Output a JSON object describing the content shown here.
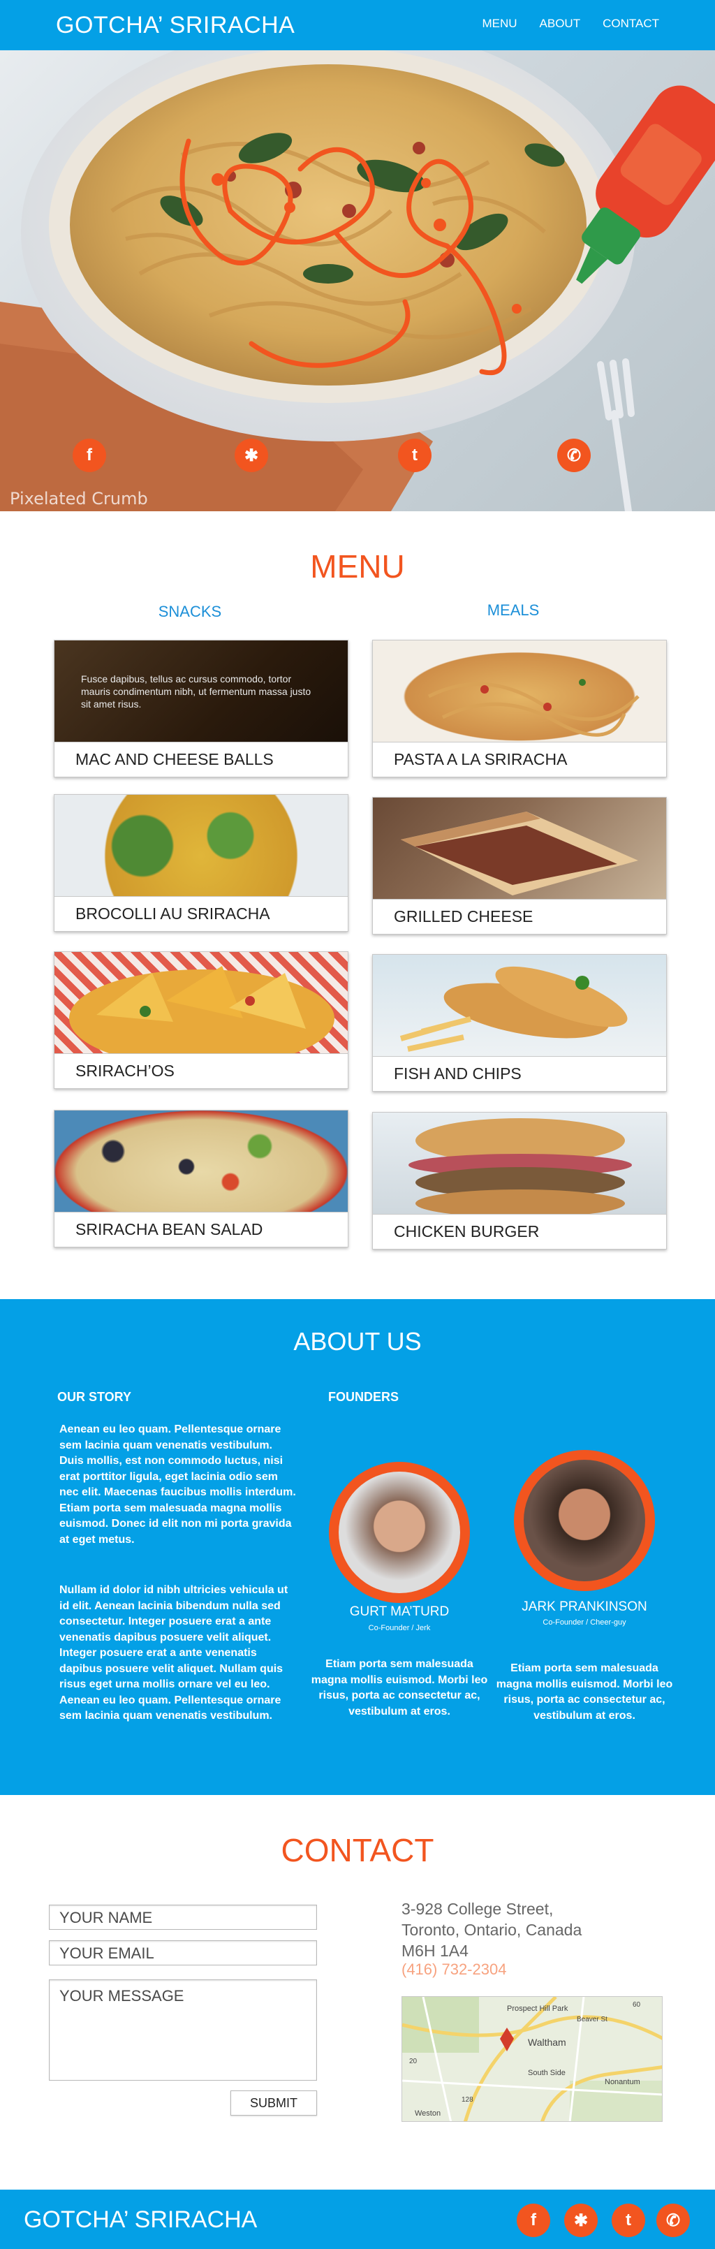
{
  "header": {
    "logo": "GOTCHA’ SRIRACHA",
    "nav": [
      "MENU",
      "ABOUT",
      "CONTACT"
    ]
  },
  "hero": {
    "watermark": "Pixelated Crumb",
    "social_icons": [
      "facebook-icon",
      "yelp-icon",
      "twitter-icon",
      "phone-icon"
    ]
  },
  "menu": {
    "title": "MENU",
    "snacks_heading": "SNACKS",
    "meals_heading": "MEALS",
    "snacks": [
      {
        "name": "MAC AND CHEESE BALLS",
        "overlay": "Fusce dapibus, tellus ac cursus commodo, tortor mauris condimentum nibh, ut fermentum massa justo sit amet risus."
      },
      {
        "name": "BROCOLLI AU SRIRACHA"
      },
      {
        "name": "SRIRACH’OS"
      },
      {
        "name": "SRIRACHA BEAN SALAD"
      }
    ],
    "meals": [
      {
        "name": "PASTA A LA SRIRACHA"
      },
      {
        "name": "GRILLED CHEESE"
      },
      {
        "name": "FISH AND CHIPS"
      },
      {
        "name": "CHICKEN BURGER"
      }
    ]
  },
  "about": {
    "title": "ABOUT US",
    "story_heading": "OUR STORY",
    "founders_heading": "FOUNDERS",
    "story_paragraphs": [
      "Aenean eu leo quam. Pellentesque ornare sem lacinia quam venenatis vestibulum. Duis mollis, est non commodo luctus, nisi erat porttitor ligula, eget lacinia odio sem nec elit. Maecenas faucibus mollis interdum. Etiam porta sem malesuada magna mollis euismod. Donec id elit non mi porta gravida at eget metus.",
      "Nullam id dolor id nibh ultricies vehicula ut id elit. Aenean lacinia bibendum nulla sed consectetur. Integer posuere erat a ante venenatis dapibus posuere velit aliquet. Integer posuere erat a ante venenatis dapibus posuere velit aliquet. Nullam quis risus eget urna mollis ornare vel eu leo. Aenean eu leo quam. Pellentesque ornare sem lacinia quam venenatis vestibulum."
    ],
    "founders": [
      {
        "name": "GURT MA’TURD",
        "role": "Co-Founder / Jerk",
        "bio": "Etiam porta sem malesuada magna mollis euismod. Morbi leo risus, porta ac consectetur ac, vestibulum at eros."
      },
      {
        "name": "JARK PRANKINSON",
        "role": "Co-Founder / Cheer-guy",
        "bio": "Etiam porta sem malesuada magna mollis euismod. Morbi leo risus, porta ac consectetur ac, vestibulum at eros."
      }
    ]
  },
  "contact": {
    "title": "CONTACT",
    "name_placeholder": "YOUR NAME",
    "email_placeholder": "YOUR EMAIL",
    "message_placeholder": "YOUR MESSAGE",
    "submit_label": "SUBMIT",
    "address_lines": [
      "3-928 College Street,",
      "Toronto, Ontario, Canada",
      "M6H 1A4"
    ],
    "phone": "(416) 732-2304",
    "map_labels": [
      "Prospect Hill Park",
      "Waltham",
      "South Side",
      "Nonantum",
      "Weston",
      "Beaver St",
      "60",
      "128",
      "20"
    ]
  },
  "footer": {
    "logo": "GOTCHA’ SRIRACHA"
  },
  "colors": {
    "brand_blue": "#04a0e6",
    "accent_orange": "#f2551f",
    "heading_blue": "#1c8fd8"
  }
}
